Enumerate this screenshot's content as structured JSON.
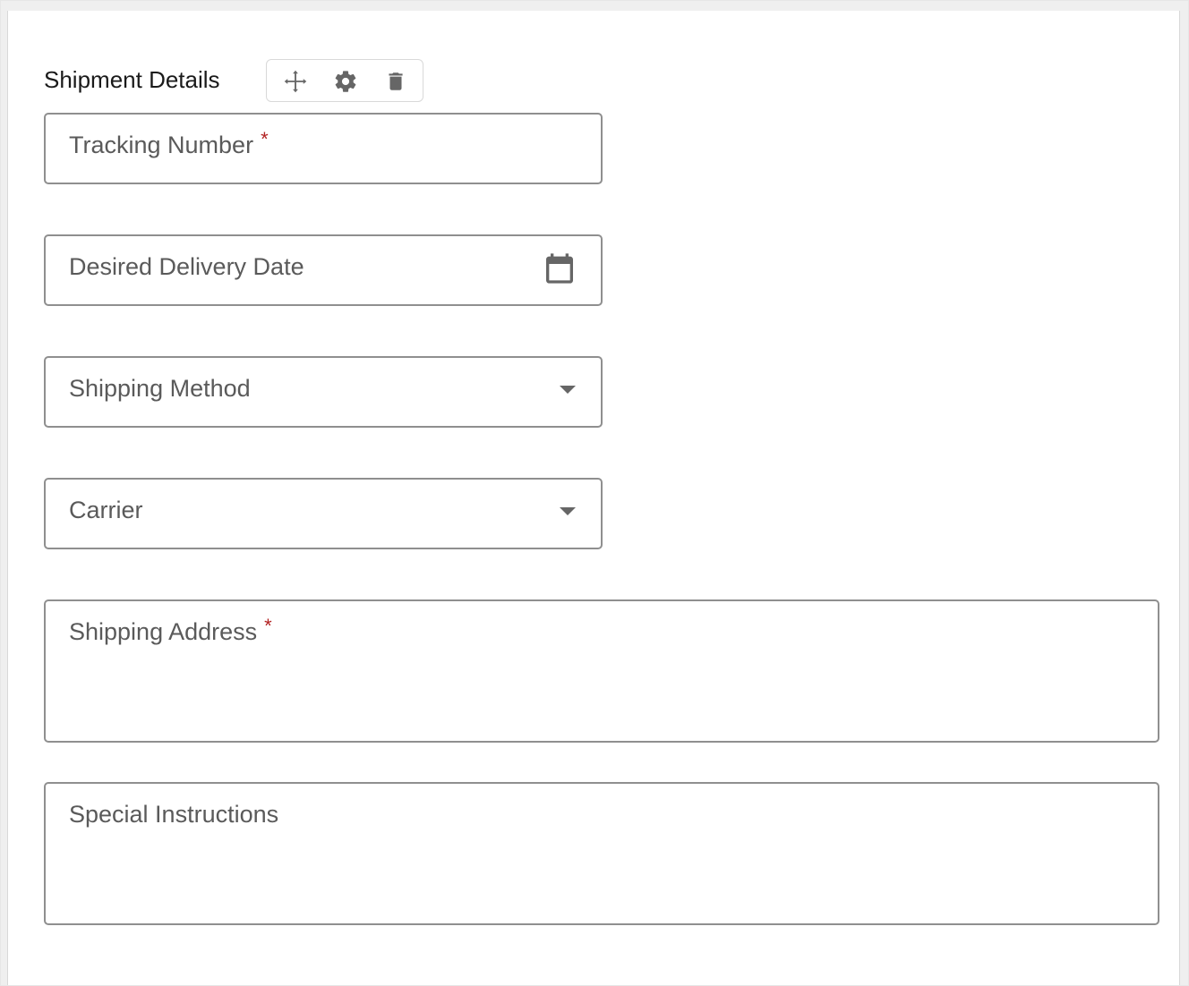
{
  "section": {
    "title": "Shipment Details"
  },
  "toolbar": {
    "icons": [
      "move-icon",
      "gear-icon",
      "trash-icon"
    ]
  },
  "fields": {
    "tracking_number": {
      "label": "Tracking Number",
      "required_marker": "*"
    },
    "desired_delivery_date": {
      "label": "Desired Delivery Date",
      "icon": "calendar-icon"
    },
    "shipping_method": {
      "label": "Shipping Method",
      "icon": "chevron-down-icon"
    },
    "carrier": {
      "label": "Carrier",
      "icon": "chevron-down-icon"
    },
    "shipping_address": {
      "label": "Shipping Address",
      "required_marker": "*"
    },
    "special_instructions": {
      "label": "Special Instructions"
    }
  },
  "colors": {
    "required": "#b22222",
    "field_border": "#8f8f8f",
    "label_text": "#5a5a5a",
    "icon": "#666666"
  }
}
